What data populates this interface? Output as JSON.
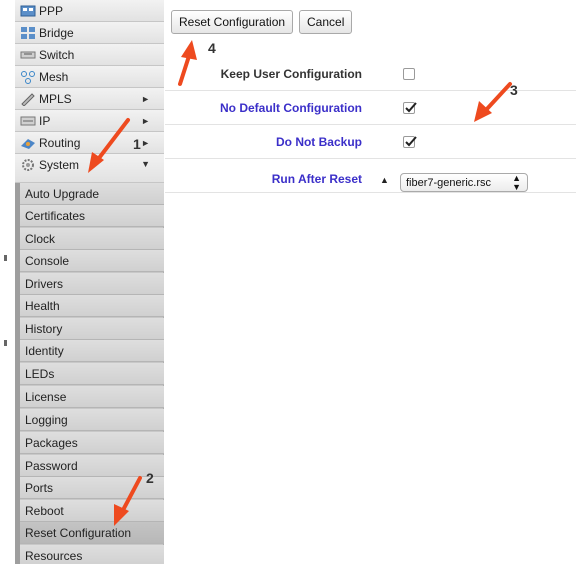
{
  "sidebar": {
    "items": [
      {
        "label": "PPP",
        "icon": "ppp-icon",
        "has_submenu": false
      },
      {
        "label": "Bridge",
        "icon": "bridge-icon",
        "has_submenu": false
      },
      {
        "label": "Switch",
        "icon": "switch-icon",
        "has_submenu": false
      },
      {
        "label": "Mesh",
        "icon": "mesh-icon",
        "has_submenu": false
      },
      {
        "label": "MPLS",
        "icon": "mpls-icon",
        "has_submenu": true
      },
      {
        "label": "IP",
        "icon": "ip-icon",
        "has_submenu": true
      },
      {
        "label": "Routing",
        "icon": "routing-icon",
        "has_submenu": true
      },
      {
        "label": "System",
        "icon": "system-gear-icon",
        "has_submenu": true,
        "expanded": true
      }
    ],
    "arrow_right": "►",
    "arrow_down": "▼",
    "system_submenu": [
      "Auto Upgrade",
      "Certificates",
      "Clock",
      "Console",
      "Drivers",
      "Health",
      "History",
      "Identity",
      "LEDs",
      "License",
      "Logging",
      "Packages",
      "Password",
      "Ports",
      "Reboot",
      "Reset Configuration",
      "Resources"
    ],
    "active_submenu": "Reset Configuration"
  },
  "toolbar": {
    "reset_label": "Reset Configuration",
    "cancel_label": "Cancel"
  },
  "form": {
    "rows": [
      {
        "label": "Keep User Configuration",
        "type": "checkbox",
        "checked": false,
        "style": "dark"
      },
      {
        "label": "No Default Configuration",
        "type": "checkbox",
        "checked": true,
        "style": "blue"
      },
      {
        "label": "Do Not Backup",
        "type": "checkbox",
        "checked": true,
        "style": "blue"
      },
      {
        "label": "Run After Reset",
        "type": "select",
        "value": "fiber7-generic.rsc",
        "style": "blue"
      }
    ],
    "collapse_triangle": "▲",
    "select_updown": "⬍"
  },
  "annotations": {
    "numbers": [
      "1",
      "2",
      "3",
      "4"
    ],
    "arrow_color": "#ee4a1f"
  }
}
